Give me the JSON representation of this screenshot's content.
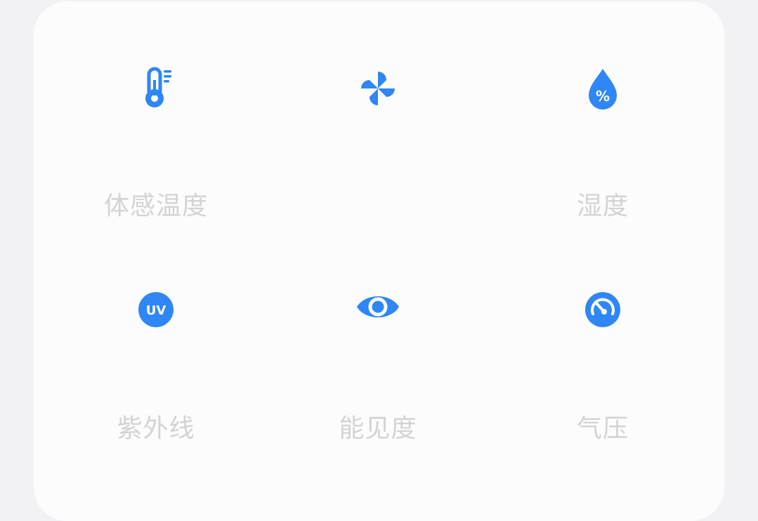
{
  "accent_color": "#2f86f6",
  "label_color": "#d3d3d3",
  "items": [
    {
      "icon": "thermometer-icon",
      "label": "体感温度"
    },
    {
      "icon": "fan-icon",
      "label": ""
    },
    {
      "icon": "humidity-drop-icon",
      "label": "湿度",
      "icon_text": "%"
    },
    {
      "icon": "uv-icon",
      "label": "紫外线",
      "icon_text": "UV"
    },
    {
      "icon": "eye-icon",
      "label": "能见度"
    },
    {
      "icon": "pressure-gauge-icon",
      "label": "气压"
    }
  ]
}
